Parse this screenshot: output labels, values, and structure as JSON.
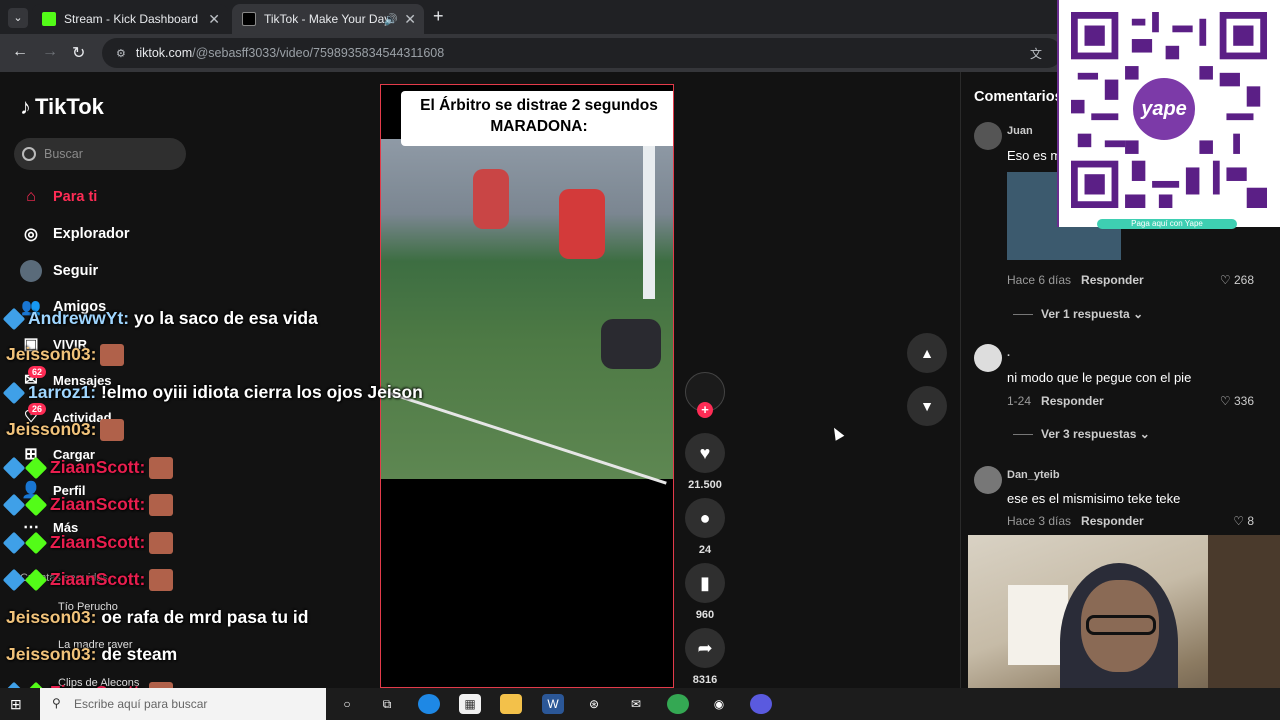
{
  "browser": {
    "tabs": [
      {
        "title": "Stream - Kick Dashboard",
        "icon": "kick-icon",
        "color": "#53fc18"
      },
      {
        "title": "TikTok - Make Your Day",
        "icon": "tiktok-icon",
        "color": "#ffffff"
      }
    ],
    "url_host": "tiktok.com",
    "url_path": "/@sebasff3033/video/7598935834544311608"
  },
  "sidebar": {
    "logo": "TikTok",
    "search_placeholder": "Buscar",
    "items": [
      {
        "label": "Para ti",
        "icon": "home-icon",
        "active": true
      },
      {
        "label": "Explorador",
        "icon": "compass-icon"
      },
      {
        "label": "Seguir",
        "icon": "following-avatar-icon"
      },
      {
        "label": "Amigos",
        "icon": "friends-icon"
      },
      {
        "label": "VIVIR",
        "icon": "live-icon"
      },
      {
        "label": "Mensajes",
        "icon": "message-icon",
        "badge": "62"
      },
      {
        "label": "Actividad",
        "icon": "activity-icon",
        "badge": "26"
      },
      {
        "label": "Cargar",
        "icon": "upload-icon"
      },
      {
        "label": "Perfil",
        "icon": "profile-icon"
      },
      {
        "label": "Más",
        "icon": "more-icon"
      }
    ],
    "accounts_header": "Cuentas seguidas",
    "accounts": [
      "Tío Perucho",
      "La madre raver",
      "Clips de Alecons"
    ]
  },
  "video": {
    "caption_line1": "El Árbitro se distrae 2 segundos",
    "caption_line2": "MARADONA:"
  },
  "actions": {
    "likes": "21.500",
    "comments": "24",
    "saves": "960",
    "shares": "8316"
  },
  "comments": {
    "title": "Comentarios",
    "items": [
      {
        "user": "Juan",
        "text": "Eso es m",
        "meta": "Hace 6 días",
        "reply": "Responder",
        "likes": "268",
        "view_replies": "Ver 1 respuesta"
      },
      {
        "user": ".",
        "text": "ni modo que le pegue con el pie",
        "meta": "1-24",
        "reply": "Responder",
        "likes": "336",
        "view_replies": "Ver 3 respuestas"
      },
      {
        "user": "Dan_yteib",
        "text": "ese es el mismisimo teke teke",
        "meta": "Hace 3 días",
        "reply": "Responder",
        "likes": "8"
      }
    ]
  },
  "chat_overlay": [
    {
      "name": "AndrewwYt:",
      "msg": "yo la saco de esa vida",
      "color": "cn3"
    },
    {
      "name": "Jeisson03:",
      "msg": "",
      "color": "cn1",
      "emote": true
    },
    {
      "name": "1arroz1:",
      "msg": "!elmo oyiii idiota cierra los ojos Jeison",
      "color": "cn3"
    },
    {
      "name": "Jeisson03:",
      "msg": "",
      "color": "cn1",
      "emote": true
    },
    {
      "name": "ZiaanScott:",
      "msg": "",
      "color": "cn2",
      "emote": true
    },
    {
      "name": "ZiaanScott:",
      "msg": "",
      "color": "cn2",
      "emote": true
    },
    {
      "name": "ZiaanScott:",
      "msg": "",
      "color": "cn2",
      "emote": true
    },
    {
      "name": "ZiaanScott:",
      "msg": "",
      "color": "cn2",
      "emote": true
    },
    {
      "name": "Jeisson03:",
      "msg": "oe rafa de mrd pasa tu id",
      "color": "cn1"
    },
    {
      "name": "Jeisson03:",
      "msg": "de steam",
      "color": "cn1"
    },
    {
      "name": "ZiaanScott:",
      "msg": "",
      "color": "cn2",
      "emote": true
    }
  ],
  "qr": {
    "brand": "yape",
    "banner": "Paga aquí con Yape"
  },
  "taskbar": {
    "search_placeholder": "Escribe aquí para buscar"
  }
}
